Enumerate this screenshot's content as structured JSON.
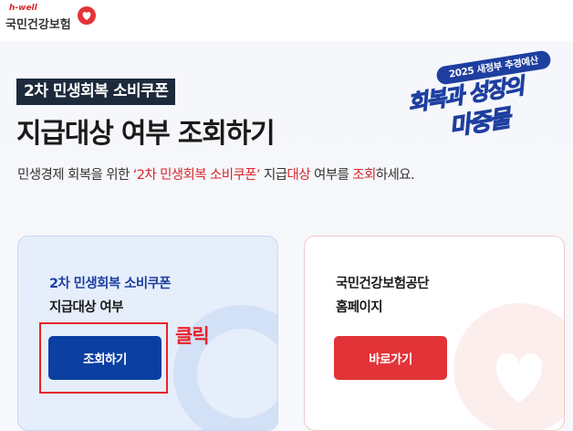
{
  "logo": {
    "sub": "h-well",
    "name": "국민건강보험"
  },
  "hero": {
    "badge": "2차 민생회복 소비쿠폰",
    "title": "지급대상 여부 조회하기",
    "desc": {
      "part1": "민생경제 회복을 위한 ",
      "part2": "‘2차 민생회복 소비쿠폰’",
      "part3": " 지급",
      "part4": "대상",
      "part5": " 여부를 ",
      "part6": "조회",
      "part7": "하세요."
    }
  },
  "slogan": {
    "pill": "2025 새정부 추경예산",
    "line1": "회복과 성장의",
    "line2": "마중물"
  },
  "cards": {
    "left": {
      "line1": "2차 민생회복 소비쿠폰",
      "line2": "지급대상 여부",
      "button": "조회하기"
    },
    "right": {
      "line1": "국민건강보험공단",
      "line2": "홈페이지",
      "button": "바로가기"
    }
  },
  "annotation": {
    "label": "클릭"
  },
  "colors": {
    "brand_red": "#e23338",
    "brand_blue": "#0b3fa1",
    "badge_dark": "#1d2a3c",
    "annotation_red": "#e8222b"
  }
}
